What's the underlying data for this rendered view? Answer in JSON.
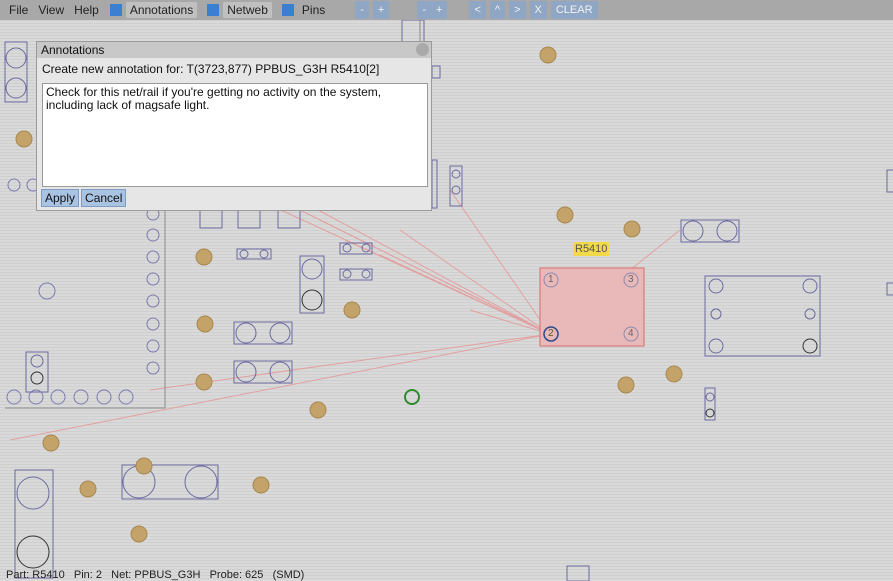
{
  "menu": {
    "file": "File",
    "view": "View",
    "help": "Help",
    "annotations_toggle": "Annotations",
    "netweb_toggle": "Netweb",
    "pins_toggle": "Pins",
    "zoom_out_1": "-",
    "zoom_in_1": "+",
    "zoom_out_2": "-",
    "zoom_in_2": "+",
    "nav_left": "<",
    "nav_up": "^",
    "nav_right": ">",
    "nav_close": "X",
    "clear": "CLEAR"
  },
  "colors": {
    "toggle_swatch": "#3b7fd1",
    "highlight_pad": "#2e8b2e",
    "selected_part_fill": "#e9b8b8",
    "selected_part_stroke": "#d86b6b",
    "netweb_line": "#e3a0a0",
    "testpoint": "#c4a36a",
    "outline": "#5a5a9a"
  },
  "dialog": {
    "title": "Annotations",
    "prompt": "Create new annotation for: T(3723,877) PPBUS_G3H R5410[2]",
    "text": "Check for this net/rail if you're getting no activity on the system, including lack of magsafe light.",
    "apply": "Apply",
    "cancel": "Cancel"
  },
  "board": {
    "selected_part_label": "R5410",
    "pin_labels": [
      "1",
      "3",
      "2",
      "4"
    ]
  },
  "status": {
    "text": "Part: R5410   Pin: 2   Net: PPBUS_G3H   Probe: 625   (SMD)"
  }
}
